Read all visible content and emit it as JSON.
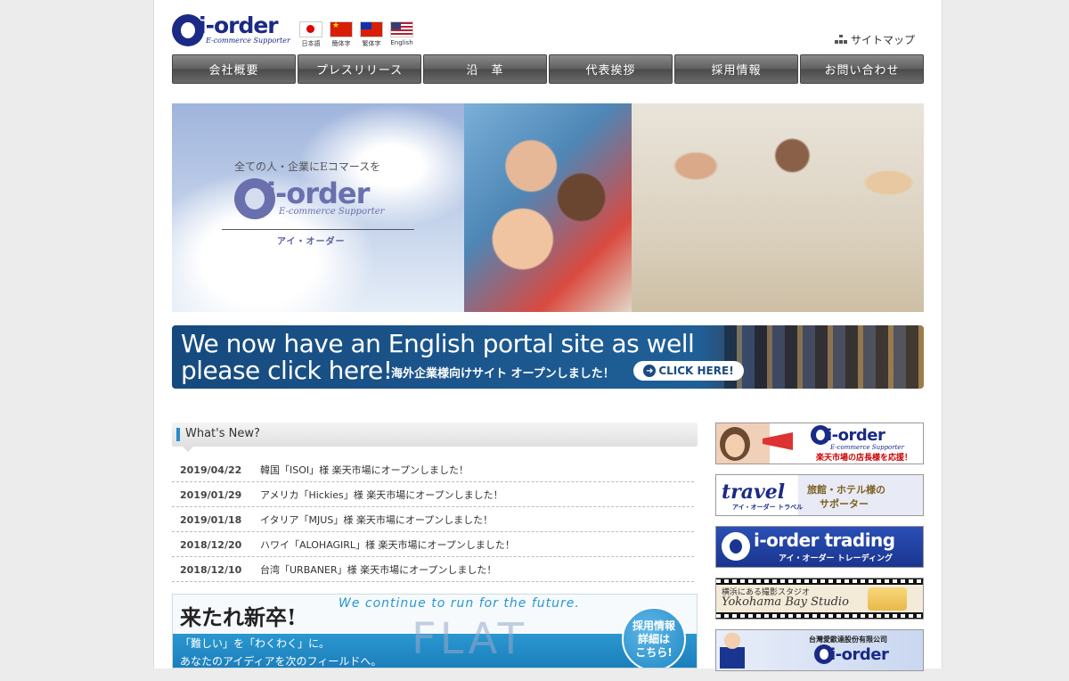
{
  "header": {
    "logo_text": "i-order",
    "logo_sub": "E-commerce Supporter",
    "languages": [
      {
        "label": "日本語",
        "flag": "jp"
      },
      {
        "label": "簡体字",
        "flag": "cn"
      },
      {
        "label": "繁体字",
        "flag": "tw"
      },
      {
        "label": "English",
        "flag": "us"
      }
    ],
    "sitemap_label": "サイトマップ",
    "sitemap_icon": "sitemap-icon"
  },
  "nav": [
    "会社概要",
    "プレスリリース",
    "沿　革",
    "代表挨拶",
    "採用情報",
    "お問い合わせ"
  ],
  "hero": {
    "tagline": "全ての人・企業にEコマースを",
    "logo_text": "i-order",
    "logo_sub": "E-commerce Supporter",
    "kana": "アイ・オーダー"
  },
  "english_banner": {
    "line1": "We now have an English portal site as well",
    "line2": "please click here!",
    "jp_text": "海外企業様向けサイト オープンしました！",
    "cta_label": "CLICK HERE!"
  },
  "news": {
    "heading": "What's New?",
    "items": [
      {
        "date": "2019/04/22",
        "text": "韓国「ISOI」様 楽天市場にオープンしました！"
      },
      {
        "date": "2019/01/29",
        "text": "アメリカ「Hickies」様 楽天市場にオープンしました！"
      },
      {
        "date": "2019/01/18",
        "text": "イタリア「MJUS」様 楽天市場にオープンしました！"
      },
      {
        "date": "2018/12/20",
        "text": "ハワイ「ALOHAGIRL」様 楽天市場にオープンしました！"
      },
      {
        "date": "2018/12/10",
        "text": "台湾「URBANER」様 楽天市場にオープンしました！"
      }
    ]
  },
  "recruit": {
    "title": "来たれ新卒!",
    "english": "We continue to run for the future.",
    "flat": "FLAT",
    "line1": "「難しい」を「わくわく」に。",
    "line2": "あなたのアイディアを次のフィールドへ。",
    "badge": [
      "採用情報",
      "詳細は",
      "こちら!"
    ]
  },
  "sidebar": {
    "b1": {
      "logo": "i-order",
      "sub": "E-commerce Supporter",
      "caption": "楽天市場の店長様を応援！"
    },
    "b2": {
      "title": "travel",
      "kana": "アイ・オーダー トラベル",
      "line1": "旅館・ホテル様の",
      "line2": "サポーター"
    },
    "b3": {
      "title": "i-order trading",
      "kana": "アイ・オーダー トレーディング"
    },
    "b4": {
      "line1": "横浜にある撮影スタジオ",
      "line2": "Yokohama Bay Studio"
    },
    "b5": {
      "company": "台灣愛歐達股份有限公司",
      "logo": "i-order"
    }
  }
}
